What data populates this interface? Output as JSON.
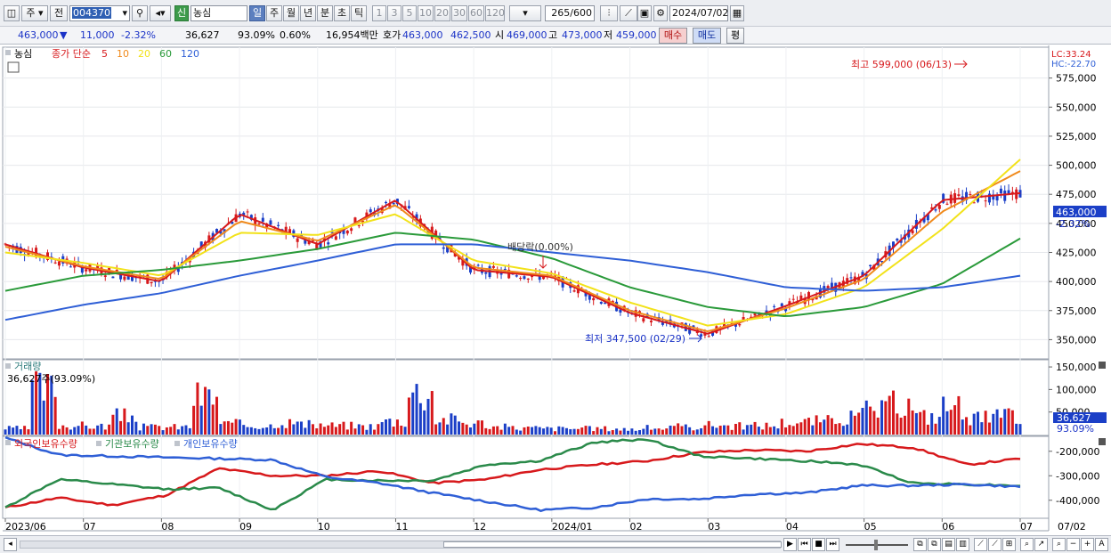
{
  "toolbar": {
    "market_label": "주",
    "prev_label": "전",
    "stock_code": "004370",
    "stock_name": "농심",
    "credit_badge": "신",
    "periods": [
      "일",
      "주",
      "월",
      "년",
      "분",
      "초",
      "틱"
    ],
    "active_period": "일",
    "intervals": [
      "1",
      "3",
      "5",
      "10",
      "20",
      "30",
      "60",
      "120"
    ],
    "count_value": "265",
    "count_max": "/600",
    "date_value": "2024/07/02"
  },
  "quote": {
    "price": "463,000",
    "change_arrow": "▼",
    "change": "11,000",
    "change_pct": "-2.32%",
    "volume": "36,627",
    "volume_ratio": "93.09%",
    "turnover_pct": "0.60%",
    "amount": "16,954백만",
    "bid_label": "호가",
    "bid_value": "463,000",
    "ask_value": "462,500",
    "open_label": "시",
    "open_value": "469,000",
    "high_label": "고",
    "high_value": "473,000",
    "low_label": "저",
    "low_value": "459,000",
    "buy_label": "매수",
    "sell_label": "매도",
    "eval_label": "평"
  },
  "price_panel": {
    "stock_tag": "농심",
    "legend_prefix": "종가 단순",
    "ma_periods": [
      "5",
      "10",
      "20",
      "60",
      "120"
    ],
    "ma_colors": [
      "#d7191c",
      "#f08a1c",
      "#f2e21a",
      "#2a9a3a",
      "#2f5fd6"
    ],
    "lc_label": "LC:33.24",
    "hc_label": "HC:-22.70",
    "y_ticks": [
      "575,000",
      "550,000",
      "525,000",
      "500,000",
      "475,000",
      "450,000",
      "425,000",
      "400,000",
      "375,000",
      "350,000"
    ],
    "current_price_tag": "463,000",
    "current_change_tag": "-2.32%",
    "high_annotation": "최고 599,000 (06/13)",
    "low_annotation": "최저 347,500 (02/29)",
    "dividend_annotation": "배당락(0.00%)"
  },
  "volume_panel": {
    "title": "거래량",
    "value_label": "36,627주(93.09%)",
    "y_ticks": [
      "150,000",
      "100,000",
      "50,000"
    ],
    "current_tag": "36,627",
    "current_pct": "93.09%"
  },
  "holdings_panel": {
    "legend": [
      "외국인보유수량",
      "기관보유수량",
      "개인보유수량"
    ],
    "legend_colors": [
      "#d7191c",
      "#2a8a4a",
      "#2f5fd6"
    ],
    "y_ticks": [
      "-200,000",
      "-300,000",
      "-400,000"
    ]
  },
  "x_axis": {
    "labels": [
      "2023/06",
      "07",
      "08",
      "09",
      "10",
      "11",
      "12",
      "2024/01",
      "02",
      "03",
      "04",
      "05",
      "06",
      "07"
    ],
    "right_label": "07/02"
  },
  "chart_data": {
    "type": "line",
    "title": "",
    "x": [
      "2023/06",
      "07",
      "08",
      "09",
      "10",
      "11",
      "12",
      "2024/01",
      "02",
      "03",
      "04",
      "05",
      "06",
      "07"
    ],
    "xlabel": "",
    "ylabel": "",
    "ylim": [
      335000,
      600000
    ],
    "series": [
      {
        "name": "5",
        "values": [
          432000,
          412000,
          400000,
          458000,
          432000,
          470000,
          410000,
          404000,
          373000,
          355000,
          379000,
          405000,
          470000,
          476000
        ]
      },
      {
        "name": "10",
        "values": [
          430000,
          413000,
          402000,
          452000,
          435000,
          466000,
          412000,
          405000,
          375000,
          357000,
          377000,
          402000,
          460000,
          495000
        ]
      },
      {
        "name": "20",
        "values": [
          425000,
          416000,
          405000,
          442000,
          440000,
          458000,
          418000,
          407000,
          382000,
          362000,
          372000,
          395000,
          445000,
          505000
        ]
      },
      {
        "name": "60",
        "values": [
          392000,
          405000,
          410000,
          418000,
          428000,
          442000,
          436000,
          420000,
          395000,
          378000,
          370000,
          378000,
          398000,
          437000
        ]
      },
      {
        "name": "120",
        "values": [
          367000,
          380000,
          390000,
          405000,
          418000,
          432000,
          432000,
          425000,
          418000,
          408000,
          395000,
          392000,
          395000,
          405000
        ]
      }
    ],
    "annotations": [
      {
        "text": "최고 599,000 (06/13)",
        "x": "06",
        "y": 599000
      },
      {
        "text": "최저 347,500 (02/29)",
        "x": "02",
        "y": 347500
      },
      {
        "text": "배당락(0.00%)",
        "x": "12",
        "y": 411000
      }
    ],
    "volume": {
      "ylim": [
        0,
        160000
      ],
      "values": [
        20000,
        150000,
        30000,
        28000,
        60000,
        25000,
        25000,
        125000,
        35000,
        30000,
        40000,
        32000,
        30000,
        28000,
        45000,
        140000,
        50000,
        38000,
        25000,
        22000,
        20000,
        20000,
        20000,
        18000,
        22000,
        25000,
        32000,
        28000,
        30000,
        40000,
        45000,
        55000,
        80000,
        100000,
        60000,
        95000,
        55000,
        60000,
        36627
      ]
    },
    "holdings": {
      "ylim": [
        -470000,
        -150000
      ],
      "foreign": [
        -430000,
        -390000,
        -420000,
        -380000,
        -270000,
        -300000,
        -300000,
        -280000,
        -330000,
        -315000,
        -275000,
        -255000,
        -240000,
        -205000,
        -195000,
        -200000,
        -170000,
        -185000,
        -255000,
        -230000
      ],
      "institution": [
        -430000,
        -315000,
        -335000,
        -355000,
        -350000,
        -440000,
        -315000,
        -320000,
        -320000,
        -255000,
        -240000,
        -165000,
        -150000,
        -220000,
        -230000,
        -240000,
        -255000,
        -330000,
        -335000,
        -340000
      ],
      "individual": [
        -145000,
        -215000,
        -220000,
        -225000,
        -230000,
        -235000,
        -305000,
        -330000,
        -370000,
        -405000,
        -440000,
        -430000,
        -395000,
        -395000,
        -375000,
        -370000,
        -340000,
        -340000,
        -335000,
        -345000
      ]
    }
  }
}
